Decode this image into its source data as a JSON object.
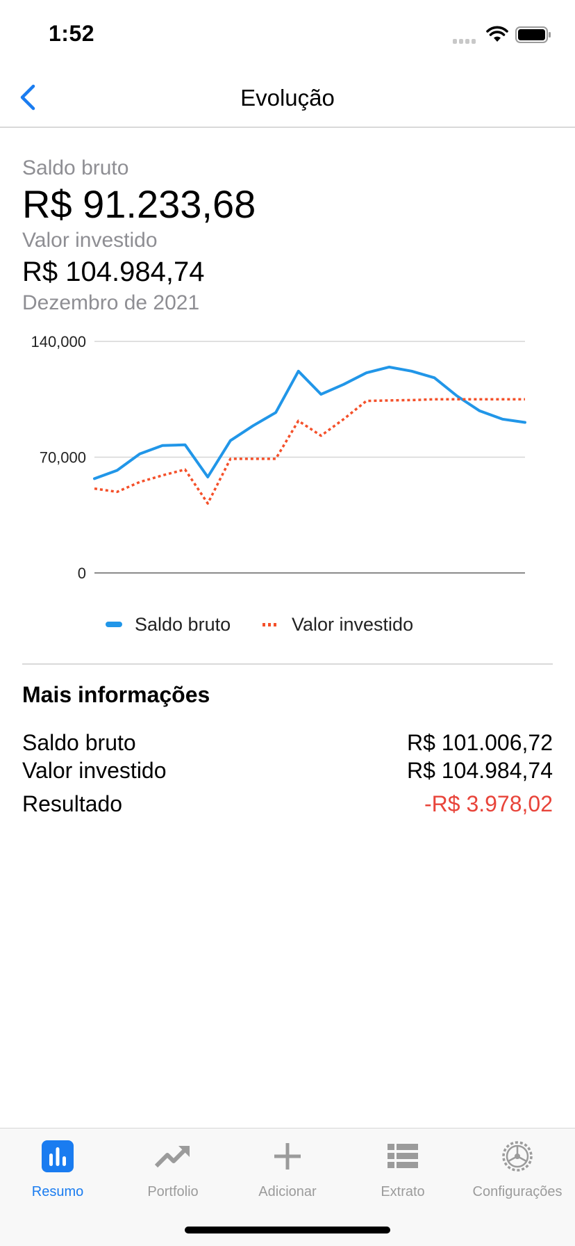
{
  "status_bar": {
    "time": "1:52"
  },
  "nav": {
    "title": "Evolução",
    "back_icon": "chevron-left-icon"
  },
  "summary": {
    "gross_label": "Saldo bruto",
    "gross_value": "R$ 91.233,68",
    "invested_label": "Valor investido",
    "invested_value": "R$ 104.984,74",
    "period": "Dezembro de 2021"
  },
  "chart_data": {
    "type": "line",
    "title": "",
    "xlabel": "",
    "ylabel": "",
    "ylim": [
      0,
      140000
    ],
    "yticks": [
      0,
      70000,
      140000
    ],
    "ytick_labels": [
      "0",
      "70,000",
      "140,000"
    ],
    "grid": true,
    "legend_position": "bottom",
    "series": [
      {
        "name": "Saldo bruto",
        "style": "solid",
        "color": "#2196e8",
        "values": [
          57000,
          62000,
          72000,
          77000,
          77500,
          58000,
          80000,
          89000,
          97000,
          122000,
          108000,
          114000,
          121000,
          124500,
          122000,
          118000,
          107000,
          98000,
          93000,
          91000
        ]
      },
      {
        "name": "Valor investido",
        "style": "dotted",
        "color": "#f4502a",
        "values": [
          51000,
          49000,
          55000,
          59000,
          62500,
          42000,
          69000,
          69000,
          69000,
          92000,
          83000,
          93000,
          104000,
          104300,
          104500,
          105000,
          105000,
          105000,
          105000,
          105000
        ]
      }
    ]
  },
  "more_info": {
    "title": "Mais informações",
    "rows": [
      {
        "label": "Saldo bruto",
        "value": "R$ 101.006,72"
      },
      {
        "label": "Valor investido",
        "value": "R$ 104.984,74"
      },
      {
        "label": "Resultado",
        "value": "-R$ 3.978,02"
      }
    ],
    "negative_color": "#e8443a"
  },
  "tab_bar": {
    "active_color": "#1a7cf0",
    "tabs": [
      {
        "label": "Resumo",
        "icon": "bar-chart-icon",
        "active": true
      },
      {
        "label": "Portfolio",
        "icon": "trending-up-icon",
        "active": false
      },
      {
        "label": "Adicionar",
        "icon": "plus-icon",
        "active": false
      },
      {
        "label": "Extrato",
        "icon": "list-icon",
        "active": false
      },
      {
        "label": "Configurações",
        "icon": "gear-icon",
        "active": false
      }
    ]
  }
}
